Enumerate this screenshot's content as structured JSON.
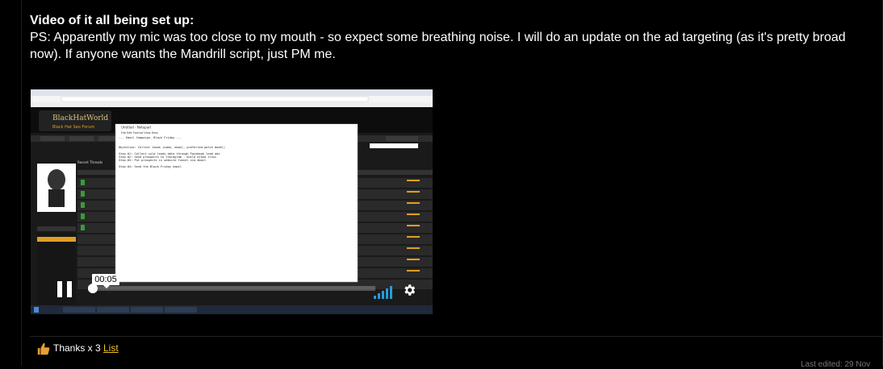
{
  "post": {
    "title": "Video of it all being set up:",
    "body": "PS: Apparently my mic was too close to my mouth - so expect some breathing noise. I will do an update on the ad targeting (as it's pretty broad now). If anyone wants the Mandrill script, just PM me."
  },
  "video": {
    "current_time": "00:05",
    "progress": 0.0,
    "screen": {
      "forum_logo": "BlackHatWorld",
      "forum_tagline": "Black Hat Seo Forum",
      "notepad_title": "Untitled - Notepad",
      "notepad_menu": [
        "File",
        "Edit",
        "Format",
        "View",
        "Help"
      ],
      "notepad_lines": [
        "--- Email Campaign, Black Friday ---",
        "",
        "Objective: Collect leads (name, email, preferred watch model)",
        "",
        "Step #1: Collect cold leads data through Facebook lead ads",
        "Step #2: Send prospects to Instagram - build brand trust",
        "Step #3: Put prospects in website funnel via email",
        "",
        "Step #4: Send the Black Friday email"
      ],
      "forum_section": "Recent Threads"
    }
  },
  "reactions": {
    "thanks_label": "Thanks x 3",
    "list_label": "List"
  },
  "corner": {
    "text": "Last edited: 29 Nov"
  },
  "colors": {
    "accent": "#f0c020",
    "volume": "#2a9ad8"
  }
}
